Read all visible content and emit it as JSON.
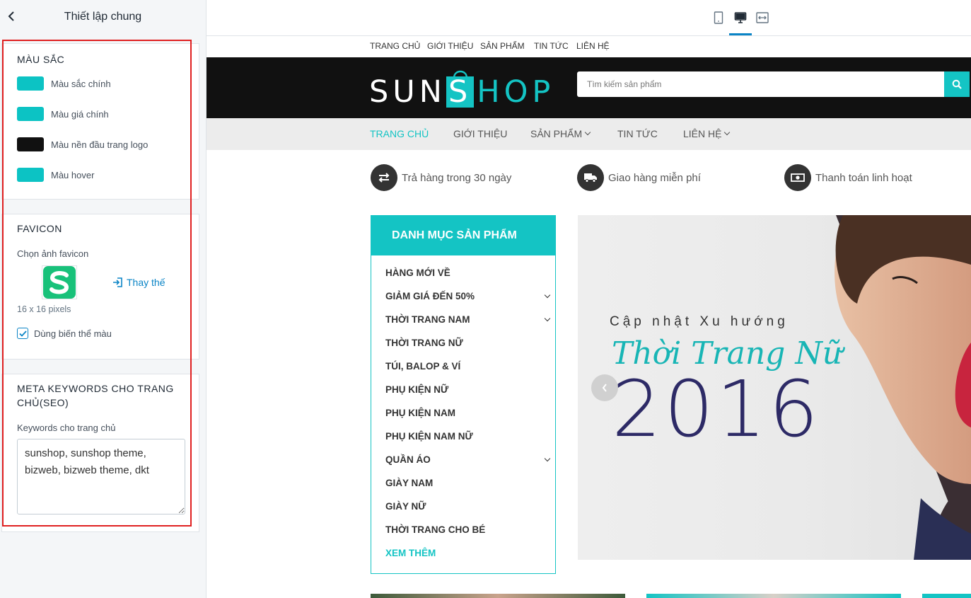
{
  "panel": {
    "title": "Thiết lập chung",
    "colors_section": {
      "title": "MÀU SẮC",
      "items": [
        {
          "label": "Màu sắc chính",
          "color": "#0cc3c4"
        },
        {
          "label": "Màu giá chính",
          "color": "#0cc3c4"
        },
        {
          "label": "Màu nền đầu trang logo",
          "color": "#111111"
        },
        {
          "label": "Màu hover",
          "color": "#0cc3c4"
        }
      ]
    },
    "favicon_section": {
      "title": "FAVICON",
      "choose_label": "Chọn ảnh favicon",
      "replace_label": "Thay thế",
      "size_note": "16 x 16 pixels",
      "checkbox_label": "Dùng biến thể màu",
      "checkbox_checked": true,
      "favicon_color": "#18c17a"
    },
    "seo_section": {
      "title": "META KEYWORDS CHO TRANG CHỦ(SEO)",
      "field_label": "Keywords cho trang chủ",
      "field_value": "sunshop, sunshop theme, bizweb, bizweb theme, dkt"
    }
  },
  "toolbar": {
    "icons": [
      "mobile-icon",
      "desktop-icon",
      "fullwidth-icon"
    ],
    "active": "desktop-icon",
    "accent": "#0a84c6"
  },
  "preview": {
    "top_links": [
      "TRANG CHỦ",
      "GIỚI THIỆU",
      "SẢN PHẨM",
      "TIN TỨC",
      "LIÊN HỆ"
    ],
    "logo": {
      "part1": "SUN",
      "part2": "S",
      "part3": "HOP"
    },
    "search_placeholder": "Tìm kiếm sản phẩm",
    "main_nav": [
      {
        "label": "TRANG CHỦ",
        "active": true,
        "dropdown": false
      },
      {
        "label": "GIỚI THIỆU",
        "active": false,
        "dropdown": false
      },
      {
        "label": "SẢN PHẨM",
        "active": false,
        "dropdown": true
      },
      {
        "label": "TIN TỨC",
        "active": false,
        "dropdown": false
      },
      {
        "label": "LIÊN HỆ",
        "active": false,
        "dropdown": true
      }
    ],
    "features": [
      {
        "icon": "exchange-icon",
        "text": "Trả hàng trong 30 ngày"
      },
      {
        "icon": "truck-icon",
        "text": "Giao hàng miễn phí"
      },
      {
        "icon": "money-icon",
        "text": "Thanh toán linh hoạt"
      }
    ],
    "category": {
      "title": "DANH MỤC SẢN PHẨM",
      "items": [
        {
          "label": "HÀNG MỚI VỀ",
          "has_sub": false
        },
        {
          "label": "GIẢM GIÁ ĐẾN 50%",
          "has_sub": true
        },
        {
          "label": "THỜI TRANG NAM",
          "has_sub": true
        },
        {
          "label": "THỜI TRANG NỮ",
          "has_sub": false
        },
        {
          "label": "TÚI, BALOP & VÍ",
          "has_sub": false
        },
        {
          "label": "PHỤ KIỆN NỮ",
          "has_sub": false
        },
        {
          "label": "PHỤ KIỆN NAM",
          "has_sub": false
        },
        {
          "label": "PHỤ KIỆN NAM NỮ",
          "has_sub": false
        },
        {
          "label": "QUẦN ÁO",
          "has_sub": true
        },
        {
          "label": "GIÀY NAM",
          "has_sub": false
        },
        {
          "label": "GIÀY NỮ",
          "has_sub": false
        },
        {
          "label": "THỜI TRANG CHO BÉ",
          "has_sub": false
        }
      ],
      "more_label": "XEM THÊM"
    },
    "banner": {
      "subtitle": "Cập nhật Xu hướng",
      "script": "Thời Trang Nữ",
      "year": "2016"
    },
    "brand_color": "#14c4c4"
  }
}
